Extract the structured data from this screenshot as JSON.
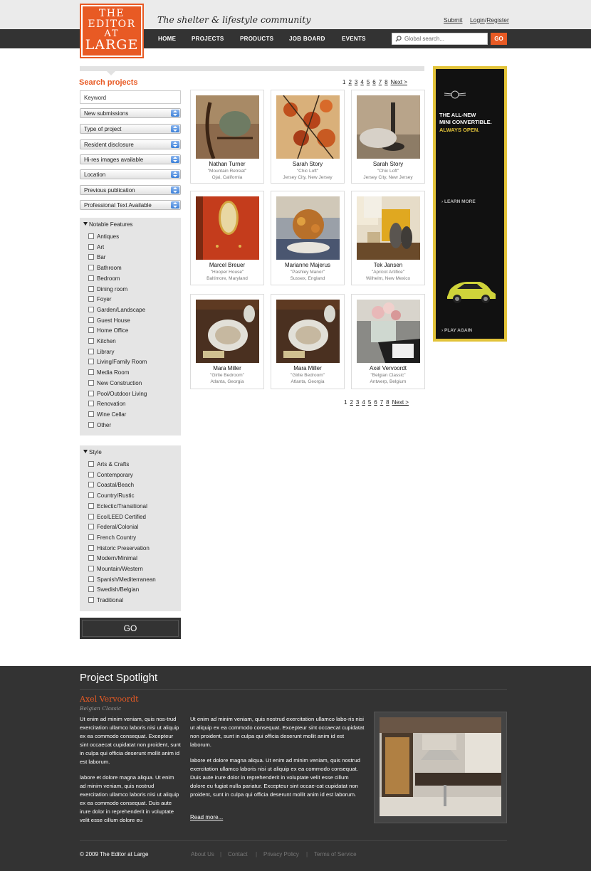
{
  "brand": {
    "logo_lines": [
      "THE",
      "EDITOR",
      "AT",
      "LARGE"
    ],
    "tagline": "The shelter & lifestyle community",
    "accent": "#e85a24"
  },
  "header": {
    "submit": "Submit",
    "login": "Login",
    "register": "Register",
    "login_sep": "/",
    "nav": [
      "HOME",
      "PROJECTS",
      "PRODUCTS",
      "JOB BOARD",
      "EVENTS"
    ],
    "search_placeholder": "Global search...",
    "go": "GO"
  },
  "sidebar": {
    "title": "Search projects",
    "keyword_placeholder": "Keyword",
    "dropdowns": [
      "New submissions",
      "Type of project",
      "Resident disclosure",
      "Hi-res images available",
      "Location",
      "Previous publication",
      "Professional Text Available"
    ],
    "features_title": "Notable Features",
    "features": [
      "Antiques",
      "Art",
      "Bar",
      "Bathroom",
      "Bedroom",
      "Dining room",
      "Foyer",
      "Garden/Landscape",
      "Guest House",
      "Home Office",
      "Kitchen",
      "Library",
      "Living/Family Room",
      "Media Room",
      "New Construction",
      "Pool/Outdoor Living",
      "Renovation",
      "Wine Cellar",
      "Other"
    ],
    "style_title": "Style",
    "styles": [
      "Arts & Crafts",
      "Contemporary",
      "Coastal/Beach",
      "Country/Rustic",
      "Eclectic/Transitional",
      "Eco/LEED Certified",
      "Federal/Colonial",
      "French Country",
      "Historic Preservation",
      "Modern/Minimal",
      "Mountain/Western",
      "Spanish/Mediterranean",
      "Swedish/Belgian",
      "Traditional"
    ],
    "go": "GO"
  },
  "pager": {
    "pages": [
      "1",
      "2",
      "3",
      "4",
      "5",
      "6",
      "7",
      "8"
    ],
    "next": "Next >"
  },
  "projects": [
    {
      "name": "Nathan Turner",
      "project": "\"Mountain Retreat\"",
      "location": "Ojai, California",
      "thumb": "chair-thumb"
    },
    {
      "name": "Sarah Story",
      "project": "\"Chic Loft\"",
      "location": "Jersey City, New Jersey",
      "thumb": "autumn-thumb"
    },
    {
      "name": "Sarah Story",
      "project": "\"Chic Loft\"",
      "location": "Jersey City, New Jersey",
      "thumb": "candle-thumb"
    },
    {
      "name": "Marcel Breuer",
      "project": "\"Hooper House\"",
      "location": "Baltimore, Maryland",
      "thumb": "red-door-thumb"
    },
    {
      "name": "Marianne Majerus",
      "project": "\"Pashley Manor\"",
      "location": "Sussex, England",
      "thumb": "flowers-thumb"
    },
    {
      "name": "Tek Jansen",
      "project": "\"Apricot Artifice\"",
      "location": "Wilhelm, New Mexico",
      "thumb": "vases-thumb"
    },
    {
      "name": "Mara Miller",
      "project": "\"Girlie Bedroom\"",
      "location": "Atlanta, Georgia",
      "thumb": "table-thumb"
    },
    {
      "name": "Mara Miller",
      "project": "\"Girlie Bedroom\"",
      "location": "Atlanta, Georgia",
      "thumb": "table-thumb"
    },
    {
      "name": "Axel Vervoordt",
      "project": "\"Belgian Classic\"",
      "location": "Antwerp, Belgium",
      "thumb": "roses-thumb"
    }
  ],
  "ad": {
    "brand": "MINI",
    "line1": "THE ALL-NEW",
    "line2": "MINI CONVERTIBLE.",
    "line3": "ALWAYS OPEN.",
    "learn": "LEARN MORE",
    "play": "PLAY AGAIN",
    "frame_color": "#e2c33a"
  },
  "spotlight": {
    "title": "Project Spotlight",
    "name": "Axel Vervoordt",
    "subtitle": "Belgian Classic",
    "col1_p1": "Ut enim ad minim veniam, quis nos-trud exercitation ullamco laboris nisi ut aliquip ex ea commodo consequat. Excepteur sint occaecat cupidatat non proident, sunt in culpa qui officia deserunt mollit anim id est laborum.",
    "col1_p2": "labore et dolore magna aliqua. Ut enim ad minim veniam, quis nostrud exercitation ullamco laboris nisi ut aliquip ex ea commodo consequat. Duis aute irure dolor in reprehenderit in voluptate velit esse cillum dolore eu",
    "col2_p1": "Ut enim ad minim veniam, quis nostrud exercitation ullamco labo-ris nisi ut aliquip ex ea commodo consequat. Excepteur sint occaecat cupidatat non proident, sunt in culpa qui officia deserunt mollit anim id est laborum.",
    "col2_p2": "labore et dolore magna aliqua. Ut enim ad minim veniam, quis nostrud exercitation ullamco laboris nisi ut aliquip ex ea commodo consequat. Duis aute irure dolor in reprehenderit in voluptate velit esse cillum dolore eu fugiat nulla pariatur. Excepteur sint occae-cat cupidatat non proident, sunt in culpa qui officia deserunt mollit anim id est laborum.",
    "read_more": "Read more..."
  },
  "footer": {
    "copyright": "© 2009 The Editor at Large",
    "links": [
      "About Us",
      "Contact",
      "Privacy Policy",
      "Terms of Service"
    ],
    "sep": "|"
  }
}
